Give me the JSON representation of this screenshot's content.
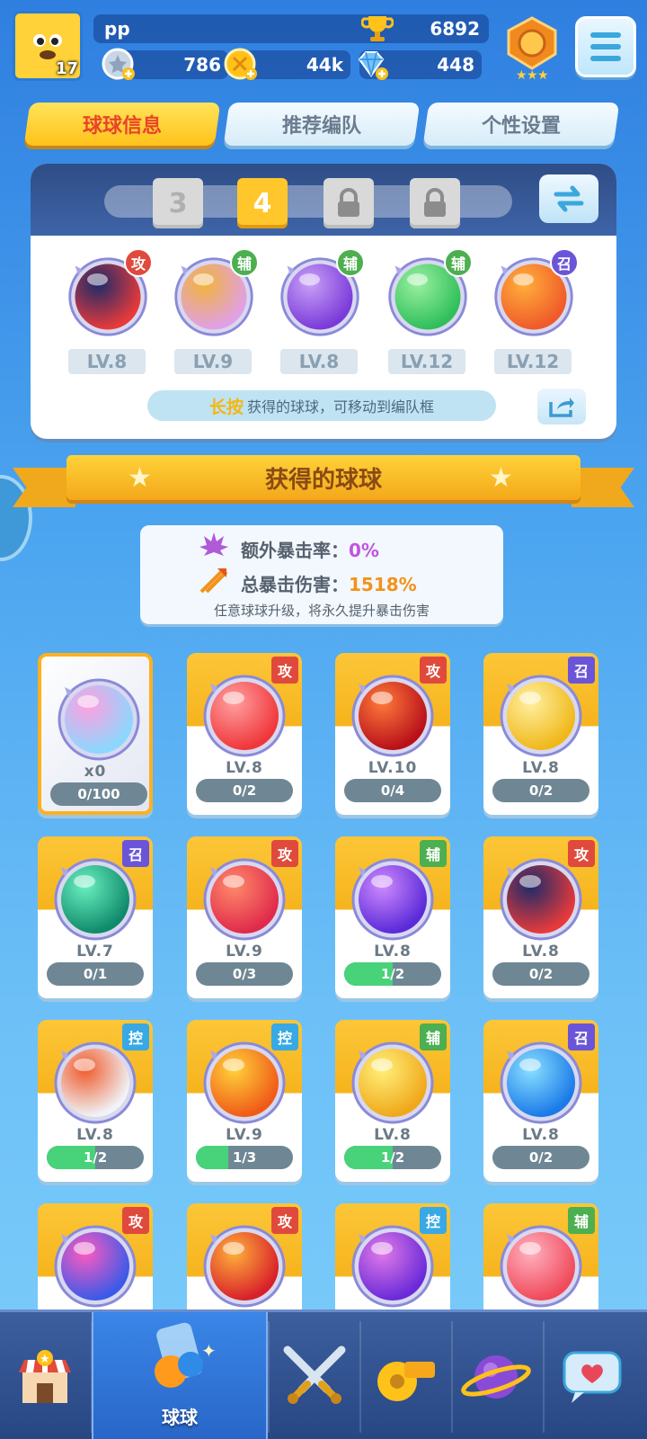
{
  "player": {
    "name": "pp",
    "level": "17",
    "trophies": "6892",
    "currencies": [
      {
        "icon": "silver-coin-icon",
        "value": "786"
      },
      {
        "icon": "gold-coin-icon",
        "value": "44k"
      },
      {
        "icon": "diamond-icon",
        "value": "448"
      }
    ]
  },
  "tabs": [
    {
      "label": "球球信息",
      "active": true
    },
    {
      "label": "推荐编队",
      "active": false
    },
    {
      "label": "个性设置",
      "active": false
    }
  ],
  "team": {
    "slots": [
      "3",
      "4",
      "",
      ""
    ],
    "active_slot": 1,
    "balls": [
      {
        "name": "opera-mask",
        "tag": "攻",
        "tag_type": "atk",
        "level": "LV.8"
      },
      {
        "name": "shadow-clones",
        "tag": "辅",
        "tag_type": "sup",
        "level": "LV.9"
      },
      {
        "name": "purple-leaf",
        "tag": "辅",
        "tag_type": "sup",
        "level": "LV.8"
      },
      {
        "name": "green-arrow",
        "tag": "辅",
        "tag_type": "sup",
        "level": "LV.12"
      },
      {
        "name": "monkey-king",
        "tag": "召",
        "tag_type": "sum",
        "level": "LV.12"
      }
    ],
    "hint_highlight": "长按",
    "hint_text": "获得的球球，可移动到编队框"
  },
  "section_title": "获得的球球",
  "crit": {
    "extra_label": "额外暴击率：",
    "extra_value": "0%",
    "total_label": "总暴击伤害：",
    "total_value": "1518%",
    "note": "任意球球升级，将永久提升暴击伤害"
  },
  "owned_balls": [
    {
      "name": "universal-ball",
      "special": true,
      "count": "x0",
      "progress": "0/100",
      "fill": 0
    },
    {
      "name": "red-blob",
      "tag": "攻",
      "tag_type": "atk",
      "level": "LV.8",
      "progress": "0/2",
      "fill": 0
    },
    {
      "name": "trident",
      "tag": "攻",
      "tag_type": "atk",
      "level": "LV.10",
      "progress": "0/4",
      "fill": 0
    },
    {
      "name": "golden-palm",
      "tag": "召",
      "tag_type": "sum",
      "level": "LV.8",
      "progress": "0/2",
      "fill": 0
    },
    {
      "name": "green-vortex",
      "tag": "召",
      "tag_type": "sum",
      "level": "LV.7",
      "progress": "0/1",
      "fill": 0
    },
    {
      "name": "red-dragon",
      "tag": "攻",
      "tag_type": "atk",
      "level": "LV.9",
      "progress": "0/3",
      "fill": 0
    },
    {
      "name": "purple-lightning",
      "tag": "辅",
      "tag_type": "sup",
      "level": "LV.8",
      "progress": "1/2",
      "fill": 0.5
    },
    {
      "name": "opera-mask",
      "tag": "攻",
      "tag_type": "atk",
      "level": "LV.8",
      "progress": "0/2",
      "fill": 0
    },
    {
      "name": "fire-horns",
      "tag": "控",
      "tag_type": "ctl",
      "level": "LV.8",
      "progress": "1/2",
      "fill": 0.5
    },
    {
      "name": "orange-star",
      "tag": "控",
      "tag_type": "ctl",
      "level": "LV.9",
      "progress": "1/3",
      "fill": 0.33
    },
    {
      "name": "sun",
      "tag": "辅",
      "tag_type": "sup",
      "level": "LV.8",
      "progress": "1/2",
      "fill": 0.5
    },
    {
      "name": "potion-bottle",
      "tag": "召",
      "tag_type": "sum",
      "level": "LV.8",
      "progress": "0/2",
      "fill": 0
    },
    {
      "name": "rainbow-prism",
      "tag": "攻",
      "tag_type": "atk",
      "level": "",
      "progress": "",
      "fill": 0
    },
    {
      "name": "phoenix",
      "tag": "攻",
      "tag_type": "atk",
      "level": "",
      "progress": "",
      "fill": 0
    },
    {
      "name": "purple-claw",
      "tag": "控",
      "tag_type": "ctl",
      "level": "",
      "progress": "",
      "fill": 0
    },
    {
      "name": "gift-box",
      "tag": "辅",
      "tag_type": "sup",
      "level": "",
      "progress": "",
      "fill": 0
    }
  ],
  "nav": [
    {
      "icon": "shop-icon",
      "label": ""
    },
    {
      "icon": "balls-icon",
      "label": "球球",
      "active": true
    },
    {
      "icon": "crossed-swords-icon",
      "label": ""
    },
    {
      "icon": "whistle-icon",
      "label": ""
    },
    {
      "icon": "planet-icon",
      "label": ""
    },
    {
      "icon": "chat-heart-icon",
      "label": ""
    }
  ],
  "colors": {
    "tab_active": "#ffc21a",
    "attack": "#e04a3c",
    "support": "#4caf50",
    "summon": "#6a55d8",
    "control": "#38a9e4",
    "progress_fill": "#48d27a"
  }
}
